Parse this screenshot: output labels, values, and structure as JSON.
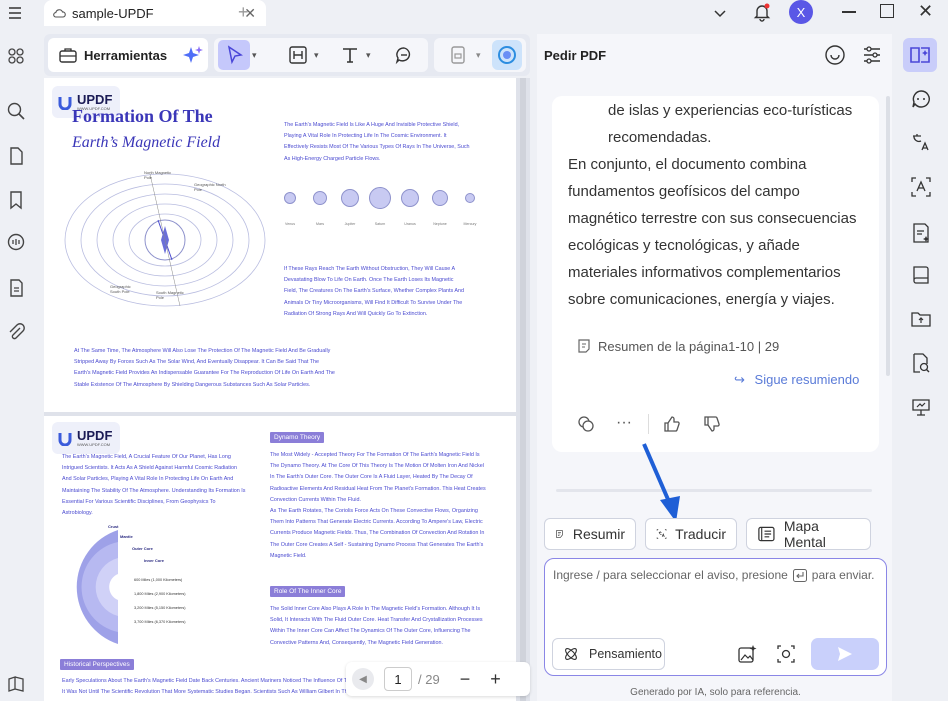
{
  "window": {
    "tab_title": "sample-UPDF",
    "avatar_letter": "X"
  },
  "toolbar": {
    "tools_label": "Herramientas"
  },
  "page1": {
    "logo_name": "UPDF",
    "logo_url": "WWW.UPDF.COM",
    "title_line1": "Formation Of The",
    "title_line2": "Earth’s Magnetic Field",
    "para1": "The Earth's Magnetic Field Is Like A Huge And Invisible Protective Shield, Playing A Vital Role In Protecting Life In The Cosmic Environment. It Effectively Resists Most Of The Various Types Of Rays In The Universe, Such As High-Energy Charged Particle Flows.",
    "para2": "If These Rays Reach The Earth Without Obstruction, They Will Cause A Devastating Blow To Life On Earth. Once The Earth Loses Its Magnetic Field, The Creatures On The Earth's Surface, Whether Complex Plants And Animals Or Tiny Microorganisms, Will Find It Difficult To Survive Under The Radiation Of Strong Rays And Will Quickly Go To Extinction.",
    "para3": "At The Same Time, The Atmosphere Will Also Lose The Protection Of The Magnetic Field And Be Gradually Stripped Away By Forces Such As The Solar Wind, And Eventually Disappear. It Can Be Said That The Earth's Magnetic Field Provides An Indispensable Guarantee For The Reproduction Of Life On Earth And The Stable Existence Of The Atmosphere By Shielding Dangerous Substances Such As Solar Particles.",
    "diagram_labels": {
      "north_geo": "North Magnetic Pole",
      "geo_north": "Geographic North Pole",
      "geo_south": "Geographic South Pole",
      "south_mag": "South Magnetic Pole"
    },
    "planets": [
      "Venus",
      "Mars",
      "Jupiter",
      "Saturn",
      "Uranus",
      "Neptune",
      "Mercury"
    ]
  },
  "page2": {
    "logo_name": "UPDF",
    "logo_url": "WWW.UPDF.COM",
    "left_para": "The Earth's Magnetic Field, A Crucial Feature Of Our Planet, Has Long Intrigued Scientists. It Acts As A Shield Against Harmful Cosmic Radiation And Solar Particles, Playing A Vital Role In Protecting Life On Earth And Maintaining The Stability Of The Atmosphere. Understanding Its Formation Is Essential For Various Scientific Disciplines, From Geophysics To Astrobiology.",
    "core_labels": [
      "Crust",
      "Mantle",
      "Outer Core",
      "Inner Core"
    ],
    "depth_labels": [
      "600 Miles (1,000 Kilometers)",
      "1,800 Miles (2,900 Kilometers)",
      "3,200 Miles (5,150 Kilometers)",
      "3,700 Miles (6,370 Kilometers)"
    ],
    "section1_title": "Dynamo Theory",
    "section1_text": "The Most Widely - Accepted Theory For The Formation Of The Earth's Magnetic Field Is The Dynamo Theory. At The Core Of This Theory Is The Motion Of Molten Iron And Nickel In The Earth's Outer Core. The Outer Core Is A Fluid Layer, Heated By The Decay Of Radioactive Elements And Residual Heat From The Planet's Formation. This Heat Creates Convection Currents Within The Fluid.",
    "section1_text2": "As The Earth Rotates, The Coriolis Force Acts On These Convective Flows, Organizing Them Into Patterns That Generate Electric Currents. According To Ampere's Law, Electric Currents Produce Magnetic Fields. Thus, The Combination Of Convection And Rotation In The Outer Core Creates A Self - Sustaining Dynamo Process That Generates The Earth's Magnetic Field.",
    "section2_title": "Role Of The Inner Core",
    "section2_text": "The Solid Inner Core Also Plays A Role In The Magnetic Field's Formation. Although It Is Solid, It Interacts With The Fluid Outer Core. Heat Transfer And Crystallization Processes Within The Inner Core Can Affect The Dynamics Of The Outer Core, Influencing The Convective Patterns And, Consequently, The Magnetic Field Generation.",
    "section3_title": "Historical Perspectives",
    "section3_text": "Early Speculations About The Earth's Magnetic Field Date Back Centuries. Ancient Mariners Noticed The Influence Of The ... It Was Not Until The Scientific Revolution That More Systematic Studies Began. Scientists Such As William Gilbert In The ..."
  },
  "pagenav": {
    "current": "1",
    "total": "/ 29"
  },
  "chat": {
    "title": "Pedir PDF",
    "lines": [
      "de islas y experiencias eco-turísticas",
      "recomendadas.",
      "En conjunto, el documento combina",
      "fundamentos geofísicos del campo",
      "magnético terrestre con sus consecuencias",
      "ecológicas y tecnológicas, y añade",
      "materiales informativos complementarios",
      "sobre comunicaciones, energía y viajes."
    ],
    "summary_ref": "Resumen de la página1-10 | 29",
    "continue_link": "Sigue resumiendo",
    "quick_actions": [
      "Resumir",
      "Traducir",
      "Mapa Mental"
    ],
    "input_placeholder_a": "Ingrese / para seleccionar el aviso, presione",
    "input_placeholder_b": "para enviar.",
    "think_label": "Pensamiento",
    "footer": "Generado por IA, solo para referencia."
  },
  "colors": {
    "accent": "#5a57e6",
    "pdf_text": "#4a4ad0",
    "arrow": "#1f5fd6"
  }
}
